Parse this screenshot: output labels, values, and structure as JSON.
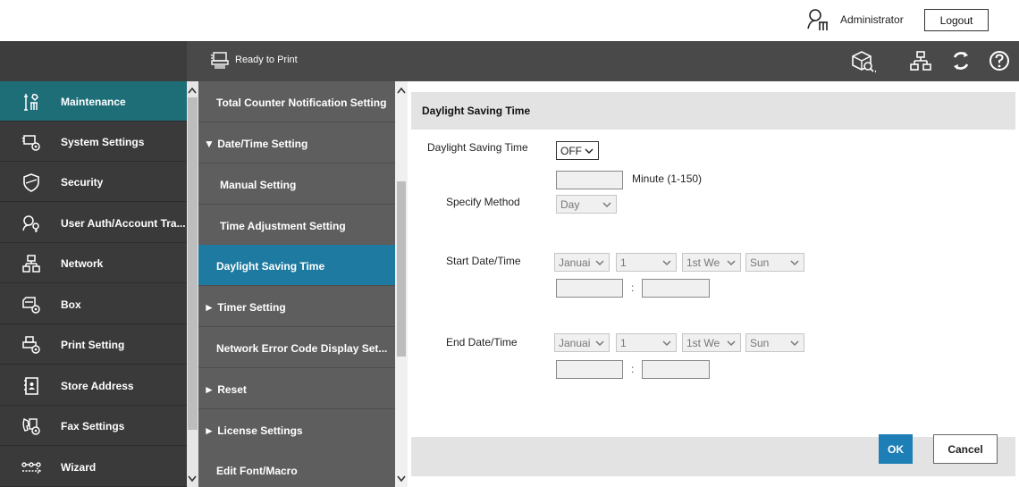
{
  "header": {
    "user_label": "Administrator",
    "logout_label": "Logout"
  },
  "status": {
    "text": "Ready to Print"
  },
  "left_menu": {
    "items": [
      {
        "label": "Maintenance",
        "icon": "maintenance-icon"
      },
      {
        "label": "System Settings",
        "icon": "system-settings-icon"
      },
      {
        "label": "Security",
        "icon": "shield-icon"
      },
      {
        "label": "User Auth/Account Tra...",
        "icon": "user-auth-icon"
      },
      {
        "label": "Network",
        "icon": "network-icon"
      },
      {
        "label": "Box",
        "icon": "box-icon"
      },
      {
        "label": "Print Setting",
        "icon": "print-setting-icon"
      },
      {
        "label": "Store Address",
        "icon": "address-book-icon"
      },
      {
        "label": "Fax Settings",
        "icon": "fax-icon"
      },
      {
        "label": "Wizard",
        "icon": "wizard-icon"
      }
    ]
  },
  "sub_menu": {
    "items": [
      {
        "label": "Total Counter Notification Setting"
      },
      {
        "label": "▼ Date/Time Setting"
      },
      {
        "label": "Manual Setting"
      },
      {
        "label": "Time Adjustment Setting"
      },
      {
        "label": "Daylight Saving Time"
      },
      {
        "label": "► Timer Setting"
      },
      {
        "label": "Network Error Code Display Set..."
      },
      {
        "label": "► Reset"
      },
      {
        "label": "► License Settings"
      },
      {
        "label": "Edit Font/Macro"
      }
    ]
  },
  "content": {
    "title": "Daylight Saving Time",
    "dst_label": "Daylight Saving Time",
    "dst_value": "OFF",
    "minute_label": "Minute (1-150)",
    "specify_label": "Specify Method",
    "specify_value": "Day",
    "start_label": "Start Date/Time",
    "end_label": "End Date/Time",
    "start": {
      "month": "Januai",
      "day": "1",
      "week": "1st We",
      "weekday": "Sun"
    },
    "end": {
      "month": "Januai",
      "day": "1",
      "week": "1st We",
      "weekday": "Sun"
    },
    "colon": ":",
    "ok_label": "OK",
    "cancel_label": "Cancel"
  },
  "colors": {
    "active_left": "#1e6e78",
    "active_sub": "#1e7aa0",
    "ok_button": "#1d7fb5"
  }
}
